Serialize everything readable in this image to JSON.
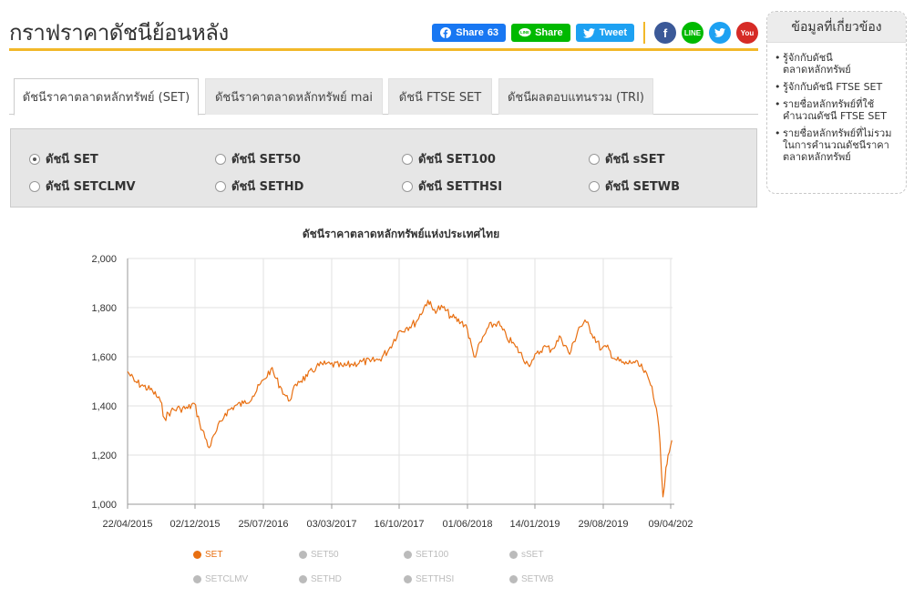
{
  "header": {
    "title": "กราฟราคาดัชนีย้อนหลัง",
    "share": {
      "facebook_label": "Share",
      "facebook_count": "63",
      "line_label": "Share",
      "twitter_label": "Tweet"
    },
    "social_icons": [
      "facebook-icon",
      "line-icon",
      "twitter-icon",
      "youtube-icon"
    ],
    "line_icon_text": "LINE",
    "youtube_icon_text": "You"
  },
  "tabs": [
    {
      "label": "ดัชนีราคาตลาดหลักทรัพย์ (SET)",
      "active": true
    },
    {
      "label": "ดัชนีราคาตลาดหลักทรัพย์ mai",
      "active": false
    },
    {
      "label": "ดัชนี FTSE SET",
      "active": false
    },
    {
      "label": "ดัชนีผลตอบแทนรวม (TRI)",
      "active": false
    }
  ],
  "radio_options": [
    {
      "label": "ดัชนี SET",
      "checked": true
    },
    {
      "label": "ดัชนี SET50",
      "checked": false
    },
    {
      "label": "ดัชนี SET100",
      "checked": false
    },
    {
      "label": "ดัชนี sSET",
      "checked": false
    },
    {
      "label": "ดัชนี SETCLMV",
      "checked": false
    },
    {
      "label": "ดัชนี SETHD",
      "checked": false
    },
    {
      "label": "ดัชนี SETTHSI",
      "checked": false
    },
    {
      "label": "ดัชนี SETWB",
      "checked": false
    }
  ],
  "chart_data": {
    "type": "line",
    "title": "ดัชนีราคาตลาดหลักทรัพย์แห่งประเทศไทย",
    "xlabel": "",
    "ylabel": "",
    "ylim": [
      1000,
      2000
    ],
    "y_ticks": [
      "1,000",
      "1,200",
      "1,400",
      "1,600",
      "1,800",
      "2,000"
    ],
    "x_ticks": [
      "22/04/2015",
      "02/12/2015",
      "25/07/2016",
      "03/03/2017",
      "16/10/2017",
      "01/06/2018",
      "14/01/2019",
      "29/08/2019",
      "09/04/202"
    ],
    "grid": true,
    "color": "#e86f11",
    "series": [
      {
        "name": "SET",
        "x": [
          "2015-04-22",
          "2015-05-15",
          "2015-06-15",
          "2015-07-15",
          "2015-08-10",
          "2015-08-24",
          "2015-09-15",
          "2015-10-15",
          "2015-11-10",
          "2015-12-02",
          "2015-12-20",
          "2016-01-21",
          "2016-02-15",
          "2016-03-15",
          "2016-04-15",
          "2016-05-15",
          "2016-06-15",
          "2016-07-25",
          "2016-08-15",
          "2016-09-15",
          "2016-10-13",
          "2016-11-15",
          "2016-12-15",
          "2017-01-15",
          "2017-02-15",
          "2017-03-03",
          "2017-04-15",
          "2017-05-15",
          "2017-06-15",
          "2017-07-15",
          "2017-08-15",
          "2017-09-15",
          "2017-10-16",
          "2017-11-15",
          "2017-12-15",
          "2018-01-24",
          "2018-02-10",
          "2018-03-15",
          "2018-04-15",
          "2018-05-15",
          "2018-06-01",
          "2018-06-28",
          "2018-08-15",
          "2018-09-15",
          "2018-10-15",
          "2018-11-15",
          "2018-12-26",
          "2019-01-14",
          "2019-02-15",
          "2019-03-15",
          "2019-04-15",
          "2019-05-15",
          "2019-06-15",
          "2019-07-10",
          "2019-08-29",
          "2019-09-15",
          "2019-10-15",
          "2019-11-15",
          "2019-12-15",
          "2020-01-15",
          "2020-02-15",
          "2020-03-01",
          "2020-03-13",
          "2020-03-23",
          "2020-04-02",
          "2020-04-09",
          "2020-04-22"
        ],
        "values": [
          1540,
          1500,
          1480,
          1460,
          1420,
          1350,
          1380,
          1390,
          1390,
          1410,
          1330,
          1230,
          1300,
          1370,
          1400,
          1410,
          1440,
          1510,
          1550,
          1480,
          1420,
          1500,
          1520,
          1560,
          1570,
          1570,
          1560,
          1570,
          1580,
          1580,
          1590,
          1630,
          1700,
          1720,
          1740,
          1830,
          1790,
          1800,
          1760,
          1740,
          1730,
          1600,
          1720,
          1740,
          1680,
          1640,
          1570,
          1590,
          1640,
          1630,
          1680,
          1610,
          1720,
          1740,
          1630,
          1640,
          1590,
          1570,
          1580,
          1550,
          1480,
          1390,
          1250,
          1030,
          1150,
          1200,
          1260
        ]
      }
    ],
    "legend": [
      "SET",
      "SET50",
      "SET100",
      "sSET",
      "SETCLMV",
      "SETHD",
      "SETTHSI",
      "SETWB"
    ],
    "legend_active": "SET"
  },
  "side": {
    "heading": "ข้อมูลที่เกี่ยวข้อง",
    "links": [
      "รู้จักกับดัชนีตลาดหลักทรัพย์",
      "รู้จักกับดัชนี FTSE SET",
      "รายชื่อหลักทรัพย์ที่ใช้คำนวณดัชนี FTSE SET",
      "รายชื่อหลักทรัพย์ที่ไม่รวมในการคำนวณดัชนีราคาตลาดหลักทรัพย์"
    ]
  }
}
